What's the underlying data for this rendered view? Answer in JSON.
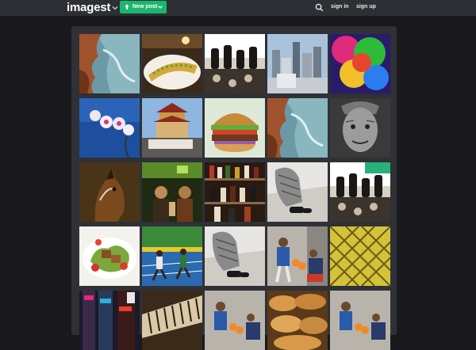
{
  "header": {
    "logo": "imagest",
    "new_post_label": "New post",
    "sign_in": "sign in",
    "sign_up": "sign up"
  },
  "colors": {
    "header_bg": "#2d2f35",
    "page_bg": "#19191d",
    "gallery_bg": "#2f3136",
    "accent_green": "#1bb76e"
  },
  "gallery": {
    "items": [
      {
        "subject": "coastal cliffs and sea"
      },
      {
        "subject": "plated food on table"
      },
      {
        "subject": "stacked dark bottles"
      },
      {
        "subject": "city skyline"
      },
      {
        "subject": "abstract colorful smoke"
      },
      {
        "subject": "pink orchid flowers"
      },
      {
        "subject": "chinese pagoda building"
      },
      {
        "subject": "hamburger"
      },
      {
        "subject": "coastal cliffs and sea"
      },
      {
        "subject": "old man portrait"
      },
      {
        "subject": "horse head"
      },
      {
        "subject": "people in green-lit room"
      },
      {
        "subject": "bottles on shelves"
      },
      {
        "subject": "feet on steps"
      },
      {
        "subject": "stacked dark bottles"
      },
      {
        "subject": "salad dish"
      },
      {
        "subject": "runners racing"
      },
      {
        "subject": "feet on steps"
      },
      {
        "subject": "man with oranges on street"
      },
      {
        "subject": "yellow woven pattern"
      },
      {
        "subject": "city street at night"
      },
      {
        "subject": "keyboard instrument"
      },
      {
        "subject": "man with oranges on street"
      },
      {
        "subject": "bread loaves"
      },
      {
        "subject": "man with oranges on street"
      }
    ]
  }
}
